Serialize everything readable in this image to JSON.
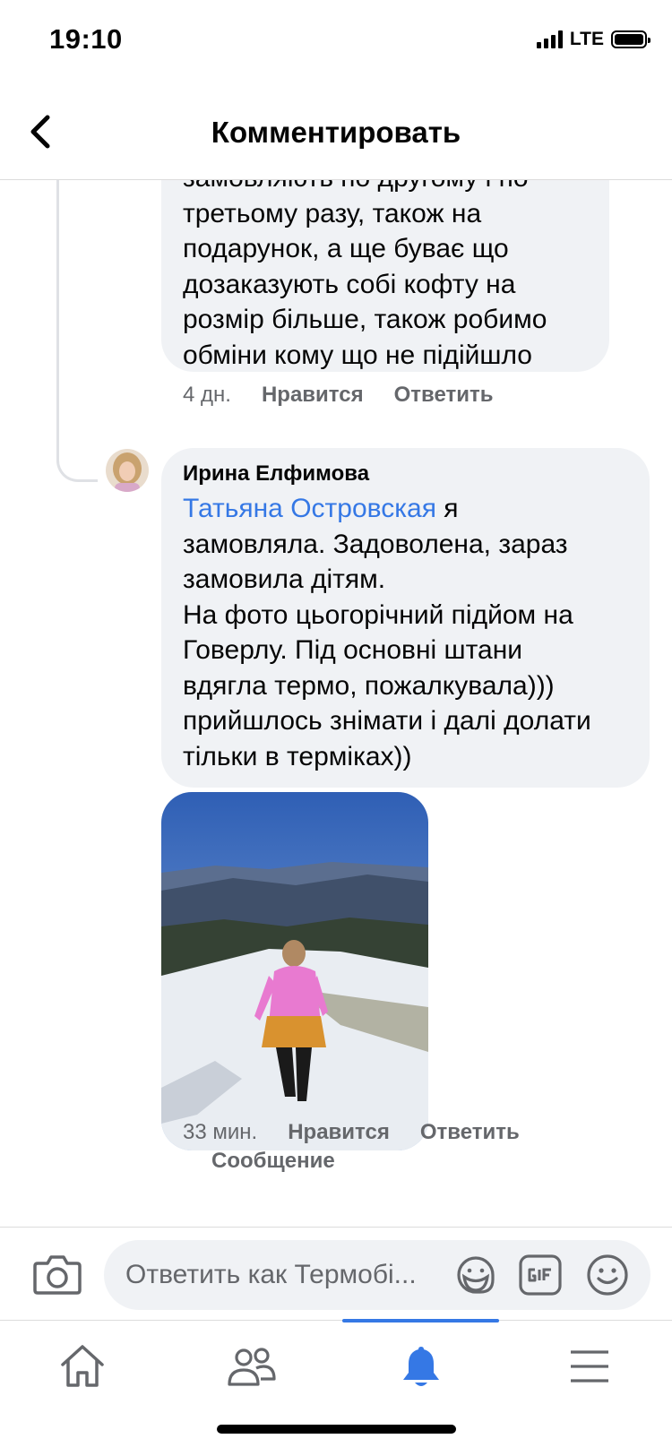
{
  "status_bar": {
    "time": "19:10",
    "network": "LTE"
  },
  "header": {
    "title": "Комментировать"
  },
  "comments": [
    {
      "text_continued": "замовляють по другому і по\nтретьому разу, також на\nподарунок, а ще буває що\nдозаказують собі кофту на\nрозмір більше, також робимо\nобміни кому що не підійшло",
      "time": "4 дн.",
      "like_label": "Нравится",
      "reply_label": "Ответить"
    },
    {
      "author": "Ирина Елфимова",
      "mention": "Татьяна Островская",
      "text_after_mention": " я\nзамовляла. Задоволена, зараз\nзамовила дітям.\nНа фото цьогорічний підйом на\nГоверлу. Під основні штани\nвдягла термо, пожалкувала)))\nприйшлось знімати і далі долати\nтільки в терміках))",
      "time": "33 мин.",
      "like_label": "Нравится",
      "reply_label": "Ответить",
      "message_label": "Сообщение"
    }
  ],
  "composer": {
    "placeholder": "Ответить как Термобі..."
  },
  "tabs": [
    {
      "icon": "home-icon"
    },
    {
      "icon": "friends-icon"
    },
    {
      "icon": "notifications-bell-icon",
      "active": true
    },
    {
      "icon": "menu-icon"
    }
  ],
  "colors": {
    "accent": "#3578e5",
    "bubble": "#f0f2f5",
    "secondary_text": "#65676b"
  }
}
